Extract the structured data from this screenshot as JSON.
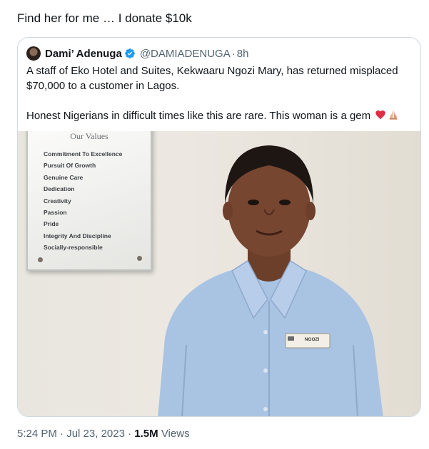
{
  "tweet": {
    "text": "Find her for me … I donate $10k"
  },
  "quote": {
    "display_name": "Dami’ Adenuga",
    "handle": "@DAMIADENUGA",
    "separator": "·",
    "time_ago": "8h",
    "paragraph1": "A staff of Eko Hotel and Suites, Kekwaaru Ngozi Mary, has returned misplaced $70,000 to a customer in Lagos.",
    "paragraph2": "Honest Nigerians in difficult times like this are rare. This woman is a gem",
    "emojis": [
      "red-heart-icon",
      "folded-hands-icon"
    ]
  },
  "photo": {
    "plaque_title": "Our Values",
    "plaque_items": [
      "Commitment To Excellence",
      "Pursuit Of Growth",
      "Genuine Care",
      "Dedication",
      "Creativity",
      "Passion",
      "Pride",
      "Integrity And Discipline",
      "Socially-responsible"
    ],
    "name_tag": "NGOZI"
  },
  "footer": {
    "time": "5:24 PM",
    "separator": "·",
    "date": "Jul 23, 2023",
    "separator2": "·",
    "views_count": "1.5M",
    "views_label": "Views"
  },
  "colors": {
    "text": "#0f1419",
    "secondary": "#536471",
    "border": "#cfd9de",
    "verified": "#1d9bf0",
    "shirt": "#a9c3e3"
  }
}
